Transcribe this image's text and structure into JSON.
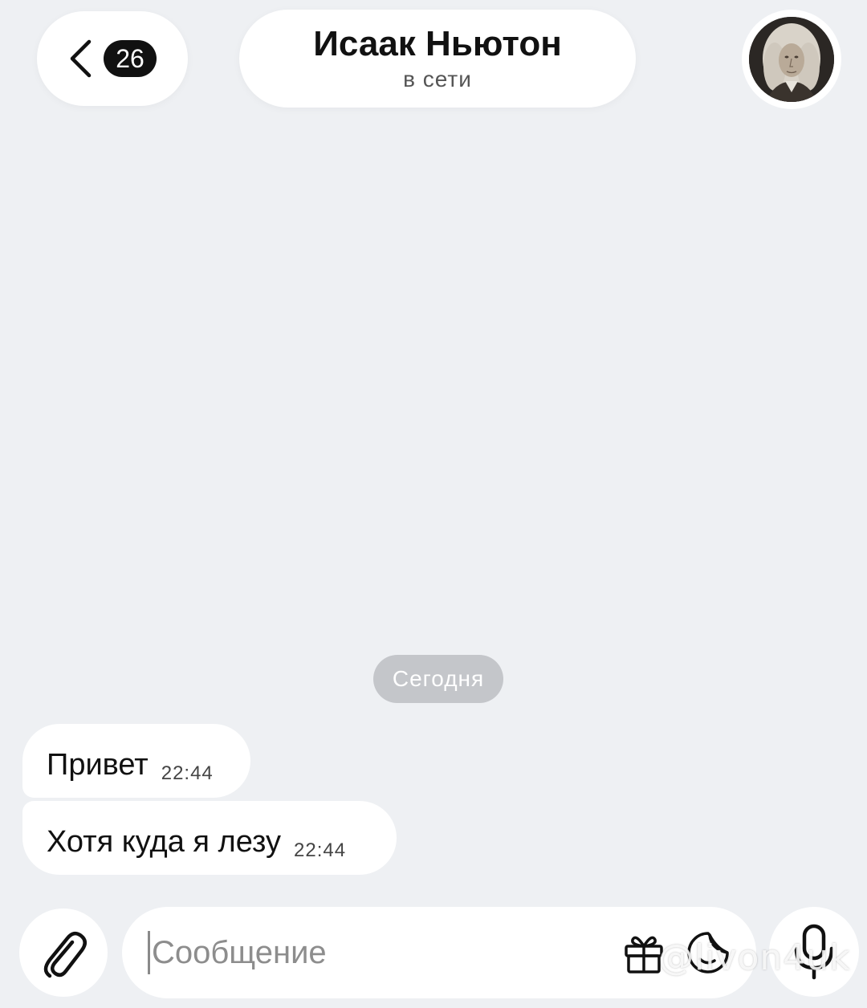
{
  "header": {
    "unread_count": "26",
    "contact_name": "Исаак Ньютон",
    "contact_status": "в сети",
    "avatar_icon": "portrait-avatar"
  },
  "chat": {
    "date_separator": "Сегодня",
    "messages": [
      {
        "text": "Привет",
        "time": "22:44"
      },
      {
        "text": "Хотя куда я лезу",
        "time": "22:44"
      }
    ]
  },
  "composer": {
    "placeholder": "Сообщение",
    "icons": [
      "paperclip-icon",
      "gift-icon",
      "sticker-icon",
      "microphone-icon"
    ]
  },
  "watermark": "@livon4uk",
  "colors": {
    "background": "#eef0f3",
    "bubble": "#ffffff",
    "badge": "#111111",
    "date_chip": "#c4c6ca"
  }
}
